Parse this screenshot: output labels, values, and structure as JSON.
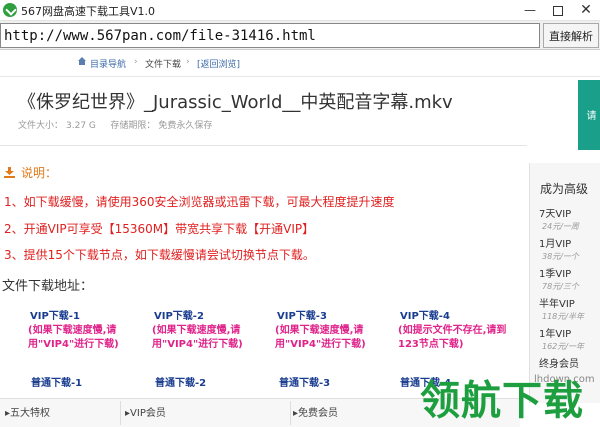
{
  "window": {
    "title": "567网盘高速下载工具V1.0",
    "minimize": "—",
    "close": "✕"
  },
  "urlbar": {
    "url": "http://www.567pan.com/file-31416.html",
    "parse_button": "直接解析"
  },
  "breadcrumb": {
    "home": "目录导航",
    "sep": "›",
    "file": "文件下载",
    "back": "[返回浏览]"
  },
  "file": {
    "title": "《侏罗纪世界》_Jurassic_World__中英配音字幕.mkv",
    "size_label": "文件大小：",
    "size_value": "3.27 G",
    "period_label": "存储期限：",
    "period_value": "免费永久保存"
  },
  "side_tab": {
    "label": "请"
  },
  "notes": {
    "heading": "说明：",
    "items": [
      "1、如下载缓慢，请使用360安全浏览器或迅雷下载，可最大程度提升速度",
      "2、开通VIP可享受【15360M】带宽共享下载【开通VIP】",
      "3、提供15个下载节点，如下载缓慢请尝试切换节点下载。"
    ]
  },
  "downloads": {
    "heading": "文件下载地址：",
    "vip": [
      {
        "label": "VIP下载-1",
        "desc": "(如果下载速度慢,请用\"VIP4\"进行下载)"
      },
      {
        "label": "VIP下载-2",
        "desc": "(如果下载速度慢,请用\"VIP4\"进行下载)"
      },
      {
        "label": "VIP下载-3",
        "desc": "(如果下载速度慢,请用\"VIP4\"进行下载)"
      },
      {
        "label": "VIP下载-4",
        "desc": "(如提示文件不存在,请到123节点下载)"
      }
    ],
    "normal": [
      "普通下载-1",
      "普通下载-2",
      "普通下载-3",
      "普通下载-4"
    ]
  },
  "bottom": {
    "col1": "五大特权",
    "col2": "VIP会员",
    "col3": "免费会员"
  },
  "price_panel": {
    "title": "成为高级",
    "plans": [
      {
        "name": "7天VIP",
        "price": "24元/一周"
      },
      {
        "name": "1月VIP",
        "price": "38元/一个"
      },
      {
        "name": "1季VIP",
        "price": "78元/三个"
      },
      {
        "name": "半年VIP",
        "price": "118元/半年"
      },
      {
        "name": "1年VIP",
        "price": "162元/一年"
      },
      {
        "name": "终身会员",
        "price": ""
      }
    ]
  },
  "watermark": {
    "site": "lhdown.com",
    "text": "领航下载"
  },
  "colors": {
    "red_note": "#e02020",
    "orange_heading": "#e07a1a",
    "vip_blue": "#1a3d8f",
    "magenta_desc": "#e0238a",
    "watermark_green": "#1d9e3f"
  }
}
